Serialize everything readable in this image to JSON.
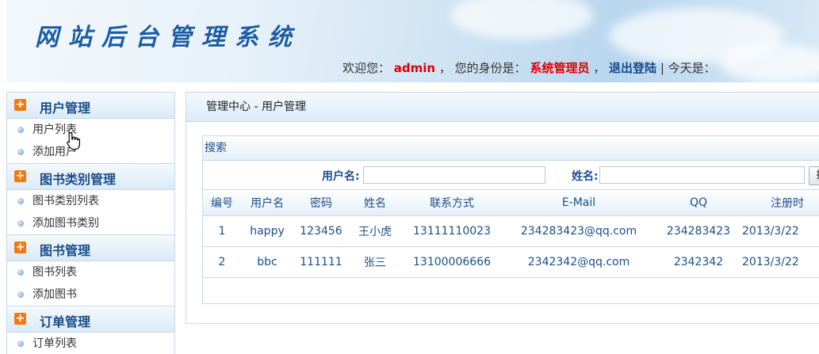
{
  "header": {
    "brand": "网站后台管理系统",
    "welcome_prefix": "欢迎您：",
    "username": "admin",
    "role_prefix": "， 您的身份是：",
    "role": "系统管理员",
    "comma": "，",
    "logout": "退出登陆",
    "today": " | 今天是："
  },
  "sidebar": {
    "groups": [
      {
        "title": "用户管理",
        "items": [
          "用户列表",
          "添加用户"
        ]
      },
      {
        "title": "图书类别管理",
        "items": [
          "图书类别列表",
          "添加图书类别"
        ]
      },
      {
        "title": "图书管理",
        "items": [
          "图书列表",
          "添加图书"
        ]
      },
      {
        "title": "订单管理",
        "items": [
          "订单列表"
        ]
      }
    ]
  },
  "main": {
    "breadcrumb": "管理中心 - 用户管理",
    "search": {
      "title": "搜索",
      "username_label": "用户名:",
      "name_label": "姓名:",
      "button": "搜"
    },
    "table": {
      "headers": [
        "编号",
        "用户名",
        "密码",
        "姓名",
        "联系方式",
        "E-Mail",
        "QQ",
        "注册时"
      ],
      "rows": [
        [
          "1",
          "happy",
          "123456",
          "王小虎",
          "13111110023",
          "234283423@qq.com",
          "234283423",
          "2013/3/22"
        ],
        [
          "2",
          "bbc",
          "111111",
          "张三",
          "13100006666",
          "2342342@qq.com",
          "2342342",
          "2013/3/22"
        ]
      ]
    }
  },
  "colors": {
    "brand": "#1b5da5",
    "highlight": "#e00000",
    "link": "#1a4a8c",
    "accent": "#f07a12"
  },
  "icons": {
    "group_toggle": "plus-square-icon",
    "item_bullet": "bullet-dot-icon",
    "cursor": "hand-pointer-icon"
  }
}
